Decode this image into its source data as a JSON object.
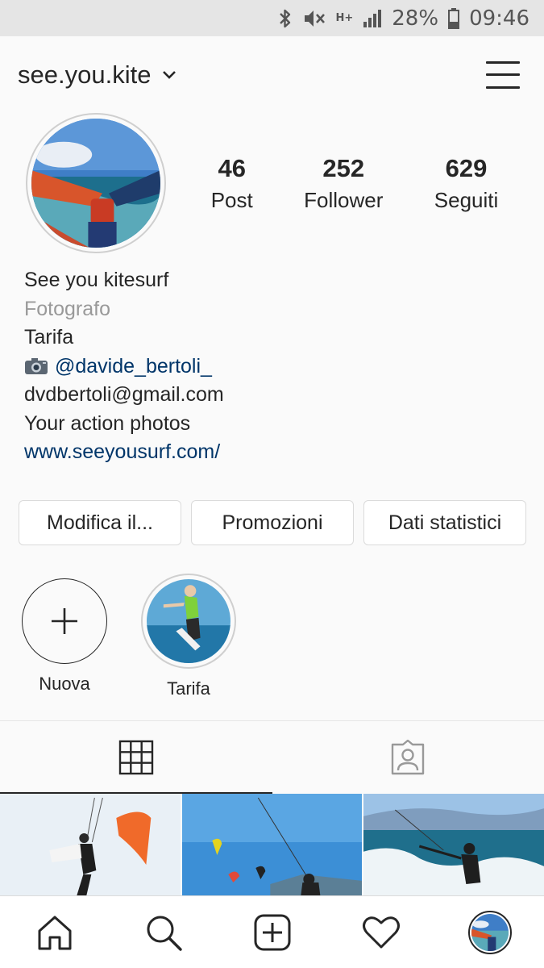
{
  "status_bar": {
    "battery": "28%",
    "time": "09:46",
    "network": "H+"
  },
  "header": {
    "username": "see.you.kite"
  },
  "stats": [
    {
      "value": "46",
      "label": "Post"
    },
    {
      "value": "252",
      "label": "Follower"
    },
    {
      "value": "629",
      "label": "Seguiti"
    }
  ],
  "bio": {
    "name": "See you kitesurf",
    "category": "Fotografo",
    "location": "Tarifa",
    "mention": "@davide_bertoli_",
    "email": "dvdbertoli@gmail.com",
    "tagline": "Your action photos",
    "website": "www.seeyousurf.com/"
  },
  "buttons": {
    "edit": "Modifica il...",
    "promotions": "Promozioni",
    "insights": "Dati statistici"
  },
  "highlights": [
    {
      "label": "Nuova"
    },
    {
      "label": "Tarifa"
    }
  ],
  "colors": {
    "link": "#003569",
    "muted": "#999999",
    "text": "#262626",
    "status_bar_bg": "#e5e5e5"
  },
  "icons": {
    "tabs": [
      "grid-icon",
      "tagged-person-icon"
    ],
    "nav": [
      "home-icon",
      "search-icon",
      "add-post-icon",
      "heart-icon",
      "profile-avatar"
    ]
  }
}
